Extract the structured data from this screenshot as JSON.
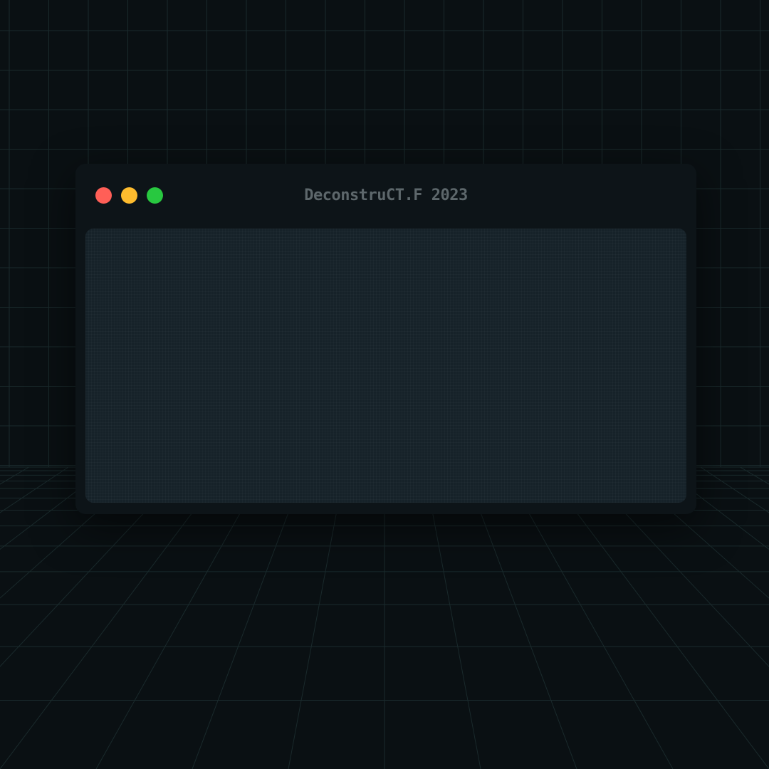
{
  "window": {
    "title": "DeconstruCT.F 2023",
    "traffic_lights": [
      {
        "name": "close",
        "color": "#ff5f57"
      },
      {
        "name": "minimize",
        "color": "#febc2e"
      },
      {
        "name": "zoom",
        "color": "#28c840"
      }
    ]
  },
  "theme": {
    "background": "#0a1013",
    "window_background": "#0d1418",
    "panel_background": "#162229",
    "title_color": "#5d676b",
    "grid_line_color": "#1a2a2c"
  }
}
